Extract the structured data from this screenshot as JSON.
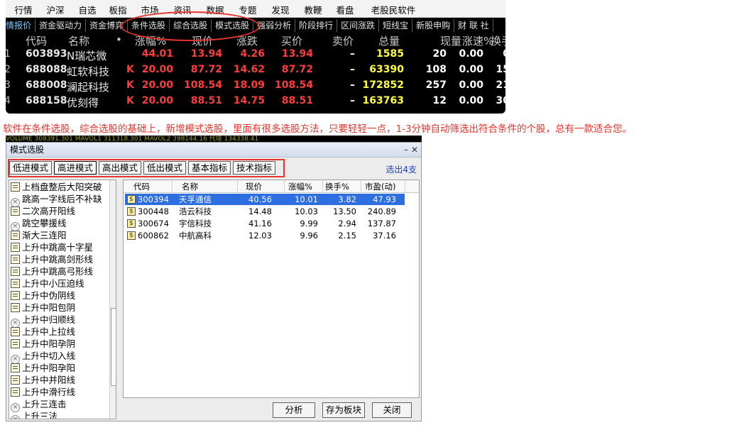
{
  "menu": [
    "行情",
    "沪深",
    "自选",
    "板指",
    "市场",
    "资讯",
    "数据",
    "专题",
    "发现",
    "教鞭",
    "看盘",
    "老股民软件"
  ],
  "func_tabs": [
    "情报价",
    "资金驱动力",
    "资金博弈",
    "条件选股",
    "综合选股",
    "模式选股",
    "强弱分析",
    "阶段排行",
    "区间涨跌",
    "短线宝",
    "新股申购",
    "财 联 社"
  ],
  "stock_columns": [
    "代码",
    "名称",
    "•",
    "涨幅%",
    "现价",
    "涨跌",
    "买价",
    "卖价",
    "总量",
    "现量",
    "涨速%",
    "换手"
  ],
  "stocks": [
    {
      "idx": "1",
      "code": "603893",
      "name": "N瑞芯微",
      "mark": "",
      "pct": "44.01",
      "price": "13.94",
      "chg": "4.26",
      "bid": "13.94",
      "ask": "–",
      "vol": "1585",
      "cur": "20",
      "speed": "0.00",
      "turn": "0"
    },
    {
      "idx": "2",
      "code": "688088",
      "name": "虹软科技",
      "mark": "K",
      "pct": "20.00",
      "price": "87.72",
      "chg": "14.62",
      "bid": "87.72",
      "ask": "–",
      "vol": "63390",
      "cur": "108",
      "speed": "0.00",
      "turn": "15"
    },
    {
      "idx": "3",
      "code": "688008",
      "name": "澜起科技",
      "mark": "K",
      "pct": "20.00",
      "price": "108.54",
      "chg": "18.09",
      "bid": "108.54",
      "ask": "–",
      "vol": "172852",
      "cur": "257",
      "speed": "0.00",
      "turn": "21"
    },
    {
      "idx": "4",
      "code": "688158",
      "name": "优刻得",
      "mark": "K",
      "pct": "20.00",
      "price": "88.51",
      "chg": "14.75",
      "bid": "88.51",
      "ask": "–",
      "vol": "163763",
      "cur": "12",
      "speed": "0.00",
      "turn": "30"
    }
  ],
  "caption": "软件在条件选股，综合选股的基础上，新增模式选股，里面有很多选股方法，只要轻轻一点，1-3分钟自动筛选出符合条件的个股，总有一款适合您。",
  "strip_text": "VOLUME  308391.301   MAVOL1  311318.301   MAVOL2  398144.16   代增 134338.41",
  "dialog": {
    "title": "模式选股",
    "controls": "–  ✕",
    "mode_tabs": [
      "低进模式",
      "高进模式",
      "高出模式",
      "低出模式",
      "基本指标",
      "技术指标"
    ],
    "result_count": "选出4支",
    "patterns": [
      {
        "icon": "doc",
        "label": "上档盘整后大阳突破"
      },
      {
        "icon": "x",
        "label": "跳高一字线后不补缺"
      },
      {
        "icon": "doc",
        "label": "二次高开阳线"
      },
      {
        "icon": "x",
        "label": "跳空攀援线"
      },
      {
        "icon": "doc",
        "label": "渐大三连阳"
      },
      {
        "icon": "doc",
        "label": "上升中跳高十字星"
      },
      {
        "icon": "doc",
        "label": "上升中跳高剑形线"
      },
      {
        "icon": "doc",
        "label": "上升中跳高弓形线"
      },
      {
        "icon": "doc",
        "label": "上升中小压迫线"
      },
      {
        "icon": "doc",
        "label": "上升中伪阴线"
      },
      {
        "icon": "doc",
        "label": "上升中阳包阴"
      },
      {
        "icon": "x",
        "label": "上升中归顺线"
      },
      {
        "icon": "doc",
        "label": "上升中上拉线"
      },
      {
        "icon": "doc",
        "label": "上升中阳孕阴"
      },
      {
        "icon": "x",
        "label": "上升中切入线"
      },
      {
        "icon": "doc",
        "label": "上升中阳孕阳"
      },
      {
        "icon": "doc",
        "label": "上升中并阳线"
      },
      {
        "icon": "doc",
        "label": "上升中滑行线"
      },
      {
        "icon": "x",
        "label": "上升三连击"
      },
      {
        "icon": "x",
        "label": "上升三法"
      }
    ],
    "grid_columns": [
      "代码",
      "名称",
      "现价",
      "涨幅%",
      "换手%",
      "市盈(动)"
    ],
    "results": [
      {
        "code": "300394",
        "name": "天孚通信",
        "price": "40.56",
        "pct": "10.01",
        "turn": "3.82",
        "pe": "47.93",
        "selected": true
      },
      {
        "code": "300448",
        "name": "浩云科技",
        "price": "14.48",
        "pct": "10.03",
        "turn": "13.50",
        "pe": "240.89",
        "selected": false
      },
      {
        "code": "300674",
        "name": "宇信科技",
        "price": "41.16",
        "pct": "9.99",
        "turn": "2.94",
        "pe": "137.87",
        "selected": false
      },
      {
        "code": "600862",
        "name": "中航高科",
        "price": "12.03",
        "pct": "9.96",
        "turn": "2.15",
        "pe": "37.16",
        "selected": false
      }
    ],
    "buttons": [
      "分析",
      "存为板块",
      "关闭"
    ]
  }
}
